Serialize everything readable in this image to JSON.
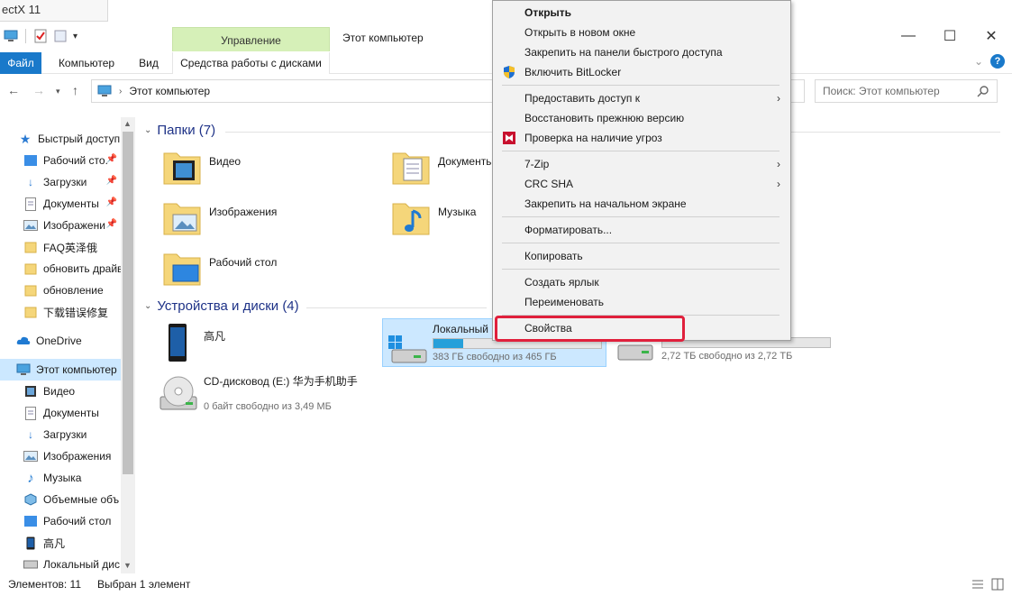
{
  "background_tab": {
    "text": "ectX 11"
  },
  "window": {
    "title": "Этот компьютер",
    "contextual_tab_group": "Управление",
    "controls": {
      "minimize": "—",
      "maximize": "☐",
      "close": "✕"
    }
  },
  "ribbon": {
    "tabs": [
      "Файл",
      "Компьютер",
      "Вид",
      "Средства работы с дисками"
    ],
    "file_tab_color": "#1979ca",
    "contextual_color": "#d6f0b8",
    "help": "?"
  },
  "address": {
    "path": "Этот компьютер",
    "search_placeholder": "Поиск: Этот компьютер"
  },
  "sidebar": {
    "items": [
      {
        "label": "Быстрый доступ",
        "icon": "star-icon",
        "pinned": false
      },
      {
        "label": "Рабочий сто.",
        "icon": "desktop-folder-icon",
        "pinned": true
      },
      {
        "label": "Загрузки",
        "icon": "download-icon",
        "pinned": true
      },
      {
        "label": "Документы",
        "icon": "documents-icon",
        "pinned": true
      },
      {
        "label": "Изображени",
        "icon": "pictures-icon",
        "pinned": true
      },
      {
        "label": "FAQ英泽俄",
        "icon": "folder-icon",
        "pinned": false
      },
      {
        "label": "обновить драйв",
        "icon": "folder-icon",
        "pinned": false
      },
      {
        "label": "обновление",
        "icon": "folder-icon",
        "pinned": false
      },
      {
        "label": "下载错误修复",
        "icon": "folder-icon",
        "pinned": false
      },
      {
        "label": "OneDrive",
        "icon": "cloud-icon",
        "pinned": false
      },
      {
        "label": "Этот компьютер",
        "icon": "computer-icon",
        "pinned": false
      },
      {
        "label": "Видео",
        "icon": "video-icon",
        "pinned": false
      },
      {
        "label": "Документы",
        "icon": "documents-icon",
        "pinned": false
      },
      {
        "label": "Загрузки",
        "icon": "download-icon",
        "pinned": false
      },
      {
        "label": "Изображения",
        "icon": "pictures-icon",
        "pinned": false
      },
      {
        "label": "Музыка",
        "icon": "music-icon",
        "pinned": false
      },
      {
        "label": "Объемные объ",
        "icon": "3d-objects-icon",
        "pinned": false
      },
      {
        "label": "Рабочий стол",
        "icon": "desktop-folder-icon",
        "pinned": false
      },
      {
        "label": "高凡",
        "icon": "phone-icon",
        "pinned": false
      },
      {
        "label": "Локальный дис",
        "icon": "drive-icon",
        "pinned": false
      }
    ],
    "selected_label": "Этот компьютер"
  },
  "folders_section": {
    "title": "Папки (7)",
    "items": [
      {
        "name": "Видео",
        "icon": "video-folder-icon"
      },
      {
        "name": "Документы",
        "icon": "documents-folder-icon"
      },
      {
        "name": "Изображения",
        "icon": "pictures-folder-icon"
      },
      {
        "name": "Музыка",
        "icon": "music-folder-icon"
      },
      {
        "name": "Рабочий стол",
        "icon": "desktop-folder-icon"
      }
    ]
  },
  "devices_section": {
    "title": "Устройства и диски (4)",
    "items": [
      {
        "name": "高凡",
        "icon": "phone-icon"
      },
      {
        "name": "Локальный",
        "free": "383 ГБ свободно из 465 ГБ",
        "used_fraction": 0.18,
        "icon": "windows-drive-icon"
      },
      {
        "name": "",
        "free": "2,72 ТБ свободно из 2,72 ТБ",
        "used_fraction": 0.0,
        "icon": "drive-icon"
      },
      {
        "name": "CD-дисковод (E:) 华为手机助手",
        "free": "0 байт свободно из 3,49 МБ",
        "icon": "cd-drive-icon"
      }
    ]
  },
  "context_menu": {
    "items": [
      {
        "label": "Открыть",
        "bold": true
      },
      {
        "label": "Открыть в новом окне"
      },
      {
        "label": "Закрепить на панели быстрого доступа"
      },
      {
        "label": "Включить BitLocker",
        "icon": "shield-icon"
      },
      {
        "label": "Предоставить доступ к",
        "submenu": true
      },
      {
        "label": "Восстановить прежнюю версию"
      },
      {
        "label": "Проверка на наличие угроз",
        "icon": "mcafee-icon"
      },
      {
        "label": "7-Zip",
        "submenu": true
      },
      {
        "label": "CRC SHA",
        "submenu": true
      },
      {
        "label": "Закрепить на начальном экране"
      },
      {
        "label": "Форматировать..."
      },
      {
        "label": "Копировать"
      },
      {
        "label": "Создать ярлык"
      },
      {
        "label": "Переименовать"
      },
      {
        "label": "Свойства"
      }
    ],
    "highlight_color": "#e0203c"
  },
  "status_bar": {
    "count": "Элементов: 11",
    "selection": "Выбран 1 элемент"
  }
}
